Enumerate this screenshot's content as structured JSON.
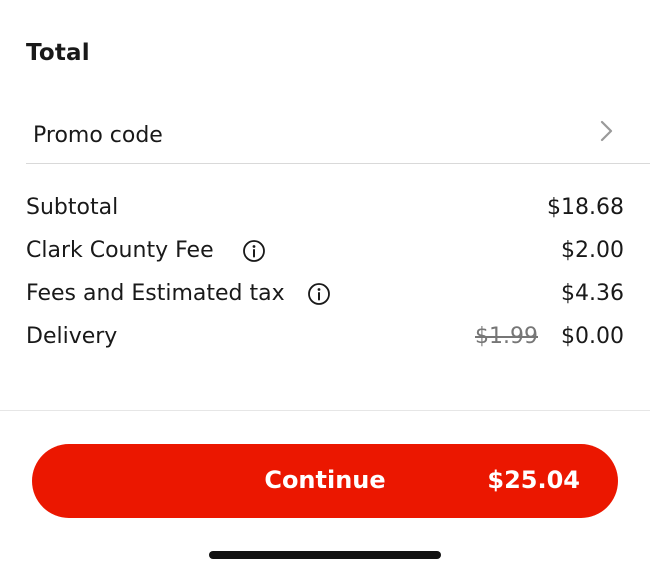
{
  "total_section": {
    "title": "Total"
  },
  "promo": {
    "label": "Promo code",
    "icon": "chevron-right-icon"
  },
  "line_items": {
    "subtotal": {
      "label": "Subtotal",
      "value": "$18.68"
    },
    "county_fee": {
      "label": "Clark County Fee",
      "value": "$2.00",
      "icon": "info-icon"
    },
    "fees_tax": {
      "label": "Fees and Estimated tax",
      "value": "$4.36",
      "icon": "info-icon"
    },
    "delivery": {
      "label": "Delivery",
      "original_value": "$1.99",
      "value": "$0.00"
    }
  },
  "continue_button": {
    "label": "Continue",
    "total": "$25.04",
    "color": "#eb1700"
  },
  "colors": {
    "text": "#191919",
    "muted": "#767676",
    "divider": "#d9d9d9"
  }
}
